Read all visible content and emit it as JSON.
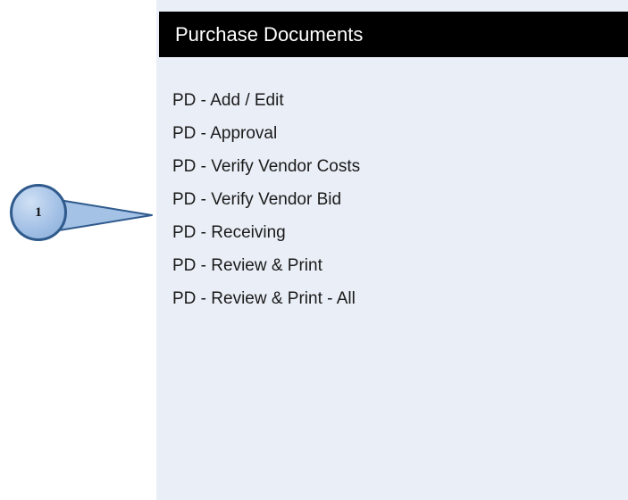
{
  "panel": {
    "title": "Purchase Documents",
    "items": [
      {
        "label": "PD - Add / Edit"
      },
      {
        "label": "PD - Approval"
      },
      {
        "label": "PD - Verify Vendor Costs"
      },
      {
        "label": "PD - Verify Vendor Bid"
      },
      {
        "label": "PD - Receiving"
      },
      {
        "label": "PD - Review & Print"
      },
      {
        "label": "PD - Review & Print - All"
      }
    ]
  },
  "callout": {
    "number": "1",
    "target_item": "PD - Verify Vendor Bid"
  },
  "colors": {
    "panel_background": "#eaeff7",
    "header_background": "#000000",
    "header_text": "#ffffff",
    "callout_border": "#2f5a8c",
    "callout_fill": "#a4c1e6"
  }
}
